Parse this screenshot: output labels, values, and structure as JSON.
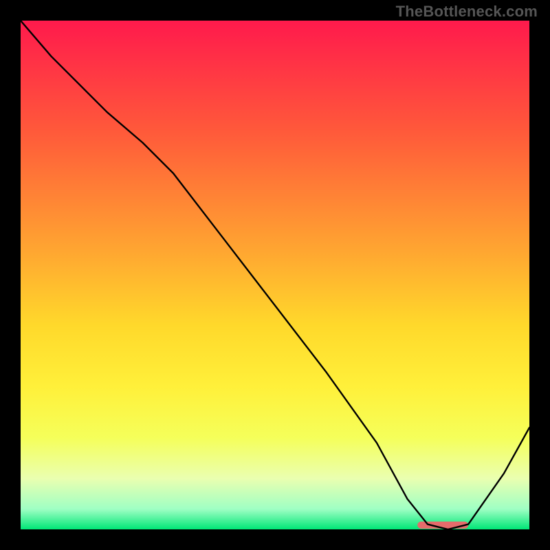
{
  "watermark": "TheBottleneck.com",
  "chart_data": {
    "type": "line",
    "title": "",
    "xlabel": "",
    "ylabel": "",
    "xlim": [
      0,
      100
    ],
    "ylim": [
      0,
      100
    ],
    "grid": false,
    "legend": false,
    "background": {
      "type": "vertical-gradient",
      "stops": [
        {
          "pct": 0,
          "color": "#ff1a4c"
        },
        {
          "pct": 22,
          "color": "#ff5a3a"
        },
        {
          "pct": 45,
          "color": "#ffa531"
        },
        {
          "pct": 60,
          "color": "#ffd92b"
        },
        {
          "pct": 72,
          "color": "#fff03a"
        },
        {
          "pct": 82,
          "color": "#f5ff5a"
        },
        {
          "pct": 90,
          "color": "#eaffb0"
        },
        {
          "pct": 96,
          "color": "#9fffc4"
        },
        {
          "pct": 100,
          "color": "#00e676"
        }
      ]
    },
    "series": [
      {
        "name": "bottleneck-curve",
        "color": "#000000",
        "x": [
          0,
          6,
          17,
          24,
          30,
          40,
          50,
          60,
          70,
          76,
          80,
          84,
          88,
          95,
          100
        ],
        "y": [
          100,
          93,
          82,
          76,
          70,
          57,
          44,
          31,
          17,
          6,
          1,
          0,
          1,
          11,
          20
        ]
      }
    ],
    "marker": {
      "name": "optimal-range",
      "shape": "rounded-bar",
      "color": "#e46b6b",
      "x_start": 78,
      "x_end": 88,
      "y": 0,
      "height_pct": 1.4
    }
  }
}
